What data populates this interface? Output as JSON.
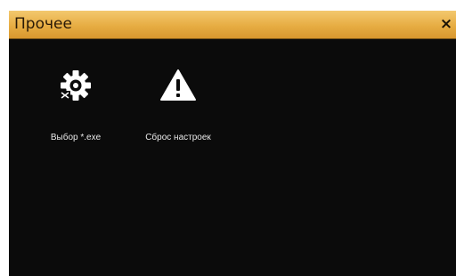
{
  "window": {
    "title": "Прочее",
    "close_label": "×"
  },
  "items": [
    {
      "label": "Выбор *.exe",
      "icon": "gear-exe-icon"
    },
    {
      "label": "Сброс настроек",
      "icon": "warning-icon"
    }
  ],
  "colors": {
    "titlebar": "#e7ad43",
    "background": "#0b0b0b",
    "icon": "#ffffff"
  }
}
